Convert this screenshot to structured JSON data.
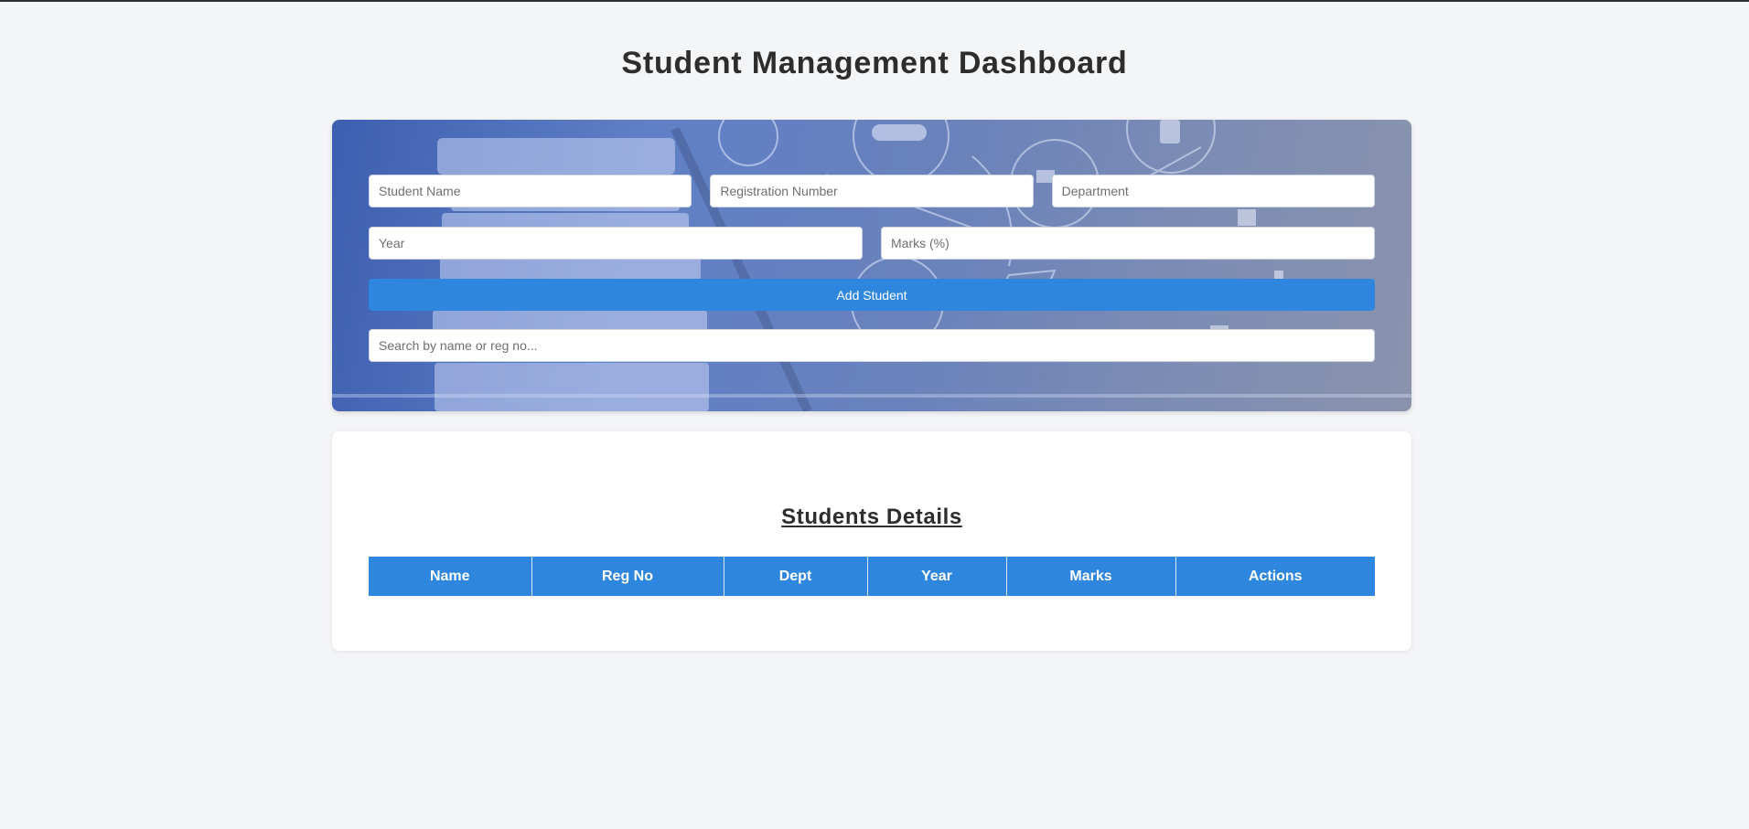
{
  "page": {
    "title": "Student Management Dashboard"
  },
  "form": {
    "student_name_placeholder": "Student Name",
    "reg_number_placeholder": "Registration Number",
    "department_placeholder": "Department",
    "year_placeholder": "Year",
    "marks_placeholder": "Marks (%)",
    "add_button_label": "Add Student",
    "search_placeholder": "Search by name or reg no..."
  },
  "table": {
    "title": "Students Details",
    "columns": [
      "Name",
      "Reg No",
      "Dept",
      "Year",
      "Marks",
      "Actions"
    ],
    "rows": []
  },
  "colors": {
    "accent": "#2e86de",
    "page_background": "#f4f5f7"
  }
}
